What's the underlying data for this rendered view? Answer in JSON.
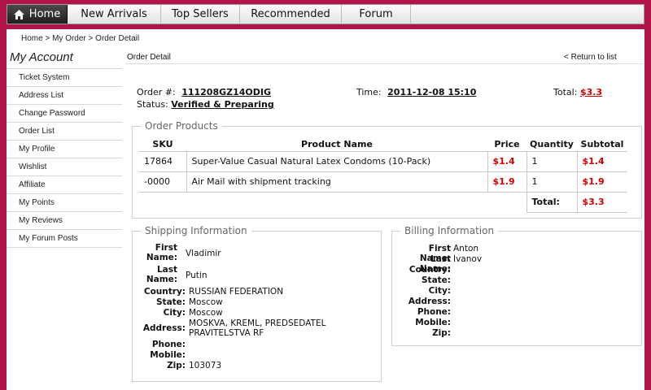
{
  "nav": {
    "items": [
      {
        "label": "Home"
      },
      {
        "label": "New Arrivals"
      },
      {
        "label": "Top Sellers"
      },
      {
        "label": "Recommended"
      },
      {
        "label": "Forum"
      }
    ]
  },
  "breadcrumb": {
    "home": "Home",
    "sep": " > ",
    "my_order": "My Order",
    "current": "Order Detail"
  },
  "sidebar": {
    "title": "My Account",
    "items": [
      {
        "label": "Ticket System"
      },
      {
        "label": "Address List"
      },
      {
        "label": "Change Password"
      },
      {
        "label": "Order List"
      },
      {
        "label": "My Profile"
      },
      {
        "label": "Wishlist"
      },
      {
        "label": "Affiliate"
      },
      {
        "label": "My Points"
      },
      {
        "label": "My Reviews"
      },
      {
        "label": "My Forum Posts"
      }
    ]
  },
  "content": {
    "heading": "Order Detail",
    "return_link": "< Return to list"
  },
  "order": {
    "number_label": "Order #:",
    "number": "111208GZ14ODIG",
    "status_label": "Status:",
    "status": "Verified & Preparing",
    "time_label": "Time:",
    "time": "2011-12-08 15:10",
    "total_label": "Total:",
    "total": "$3.3"
  },
  "products": {
    "legend": "Order Products",
    "headers": {
      "sku": "SKU",
      "name": "Product Name",
      "price": "Price",
      "quantity": "Quantity",
      "subtotal": "Subtotal"
    },
    "rows": [
      {
        "sku": "17864",
        "name": "Super-Value Casual Natural Latex Condoms (10-Pack)",
        "price": "$1.4",
        "quantity": "1",
        "subtotal": "$1.4"
      },
      {
        "sku": "-0000",
        "name": "Air Mail with shipment tracking",
        "price": "$1.9",
        "quantity": "1",
        "subtotal": "$1.9"
      }
    ],
    "total_label": "Total:",
    "total_value": "$3.3"
  },
  "shipping": {
    "legend": "Shipping Information",
    "first_name_label": "First Name:",
    "first_name": "Vladimir",
    "last_name_label": "Last Name:",
    "last_name": "Putin",
    "country_label": "Country:",
    "country": "RUSSIAN FEDERATION",
    "state_label": "State:",
    "state": "Moscow",
    "city_label": "City:",
    "city": "Moscow",
    "address_label": "Address:",
    "address": "MOSKVA, KREML, PREDSEDATEL PRAVITELSTVA RF",
    "phone_label": "Phone:",
    "phone": "",
    "mobile_label": "Mobile:",
    "mobile": "",
    "zip_label": "Zip:",
    "zip": "103073"
  },
  "billing": {
    "legend": "Billing Information",
    "first_name_label": "First Name:",
    "first_name": "Anton",
    "last_name_label": "Last Name:",
    "last_name": "Ivanov",
    "country_label": "Country:",
    "state_label": "State:",
    "city_label": "City:",
    "address_label": "Address:",
    "phone_label": "Phone:",
    "mobile_label": "Mobile:",
    "zip_label": "Zip:"
  },
  "colors": {
    "brand": "#b0144a",
    "price_red": "#d40000"
  }
}
